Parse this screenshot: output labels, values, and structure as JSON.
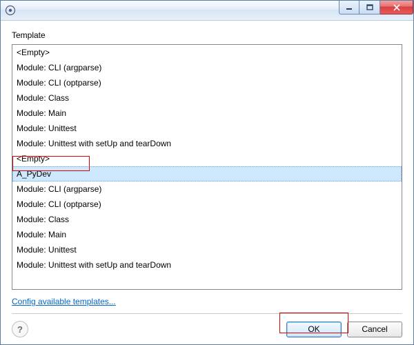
{
  "titlebar": {
    "title": ""
  },
  "section_label": "Template",
  "templates": [
    "<Empty>",
    "Module: CLI (argparse)",
    "Module: CLI (optparse)",
    "Module: Class",
    "Module: Main",
    "Module: Unittest",
    "Module: Unittest with setUp and tearDown",
    "<Empty>",
    "A_PyDev",
    "Module: CLI (argparse)",
    "Module: CLI (optparse)",
    "Module: Class",
    "Module: Main",
    "Module: Unittest",
    "Module: Unittest with setUp and tearDown"
  ],
  "selected_index": 8,
  "config_link": "Config available templates...",
  "buttons": {
    "ok": "OK",
    "cancel": "Cancel"
  },
  "help_glyph": "?"
}
